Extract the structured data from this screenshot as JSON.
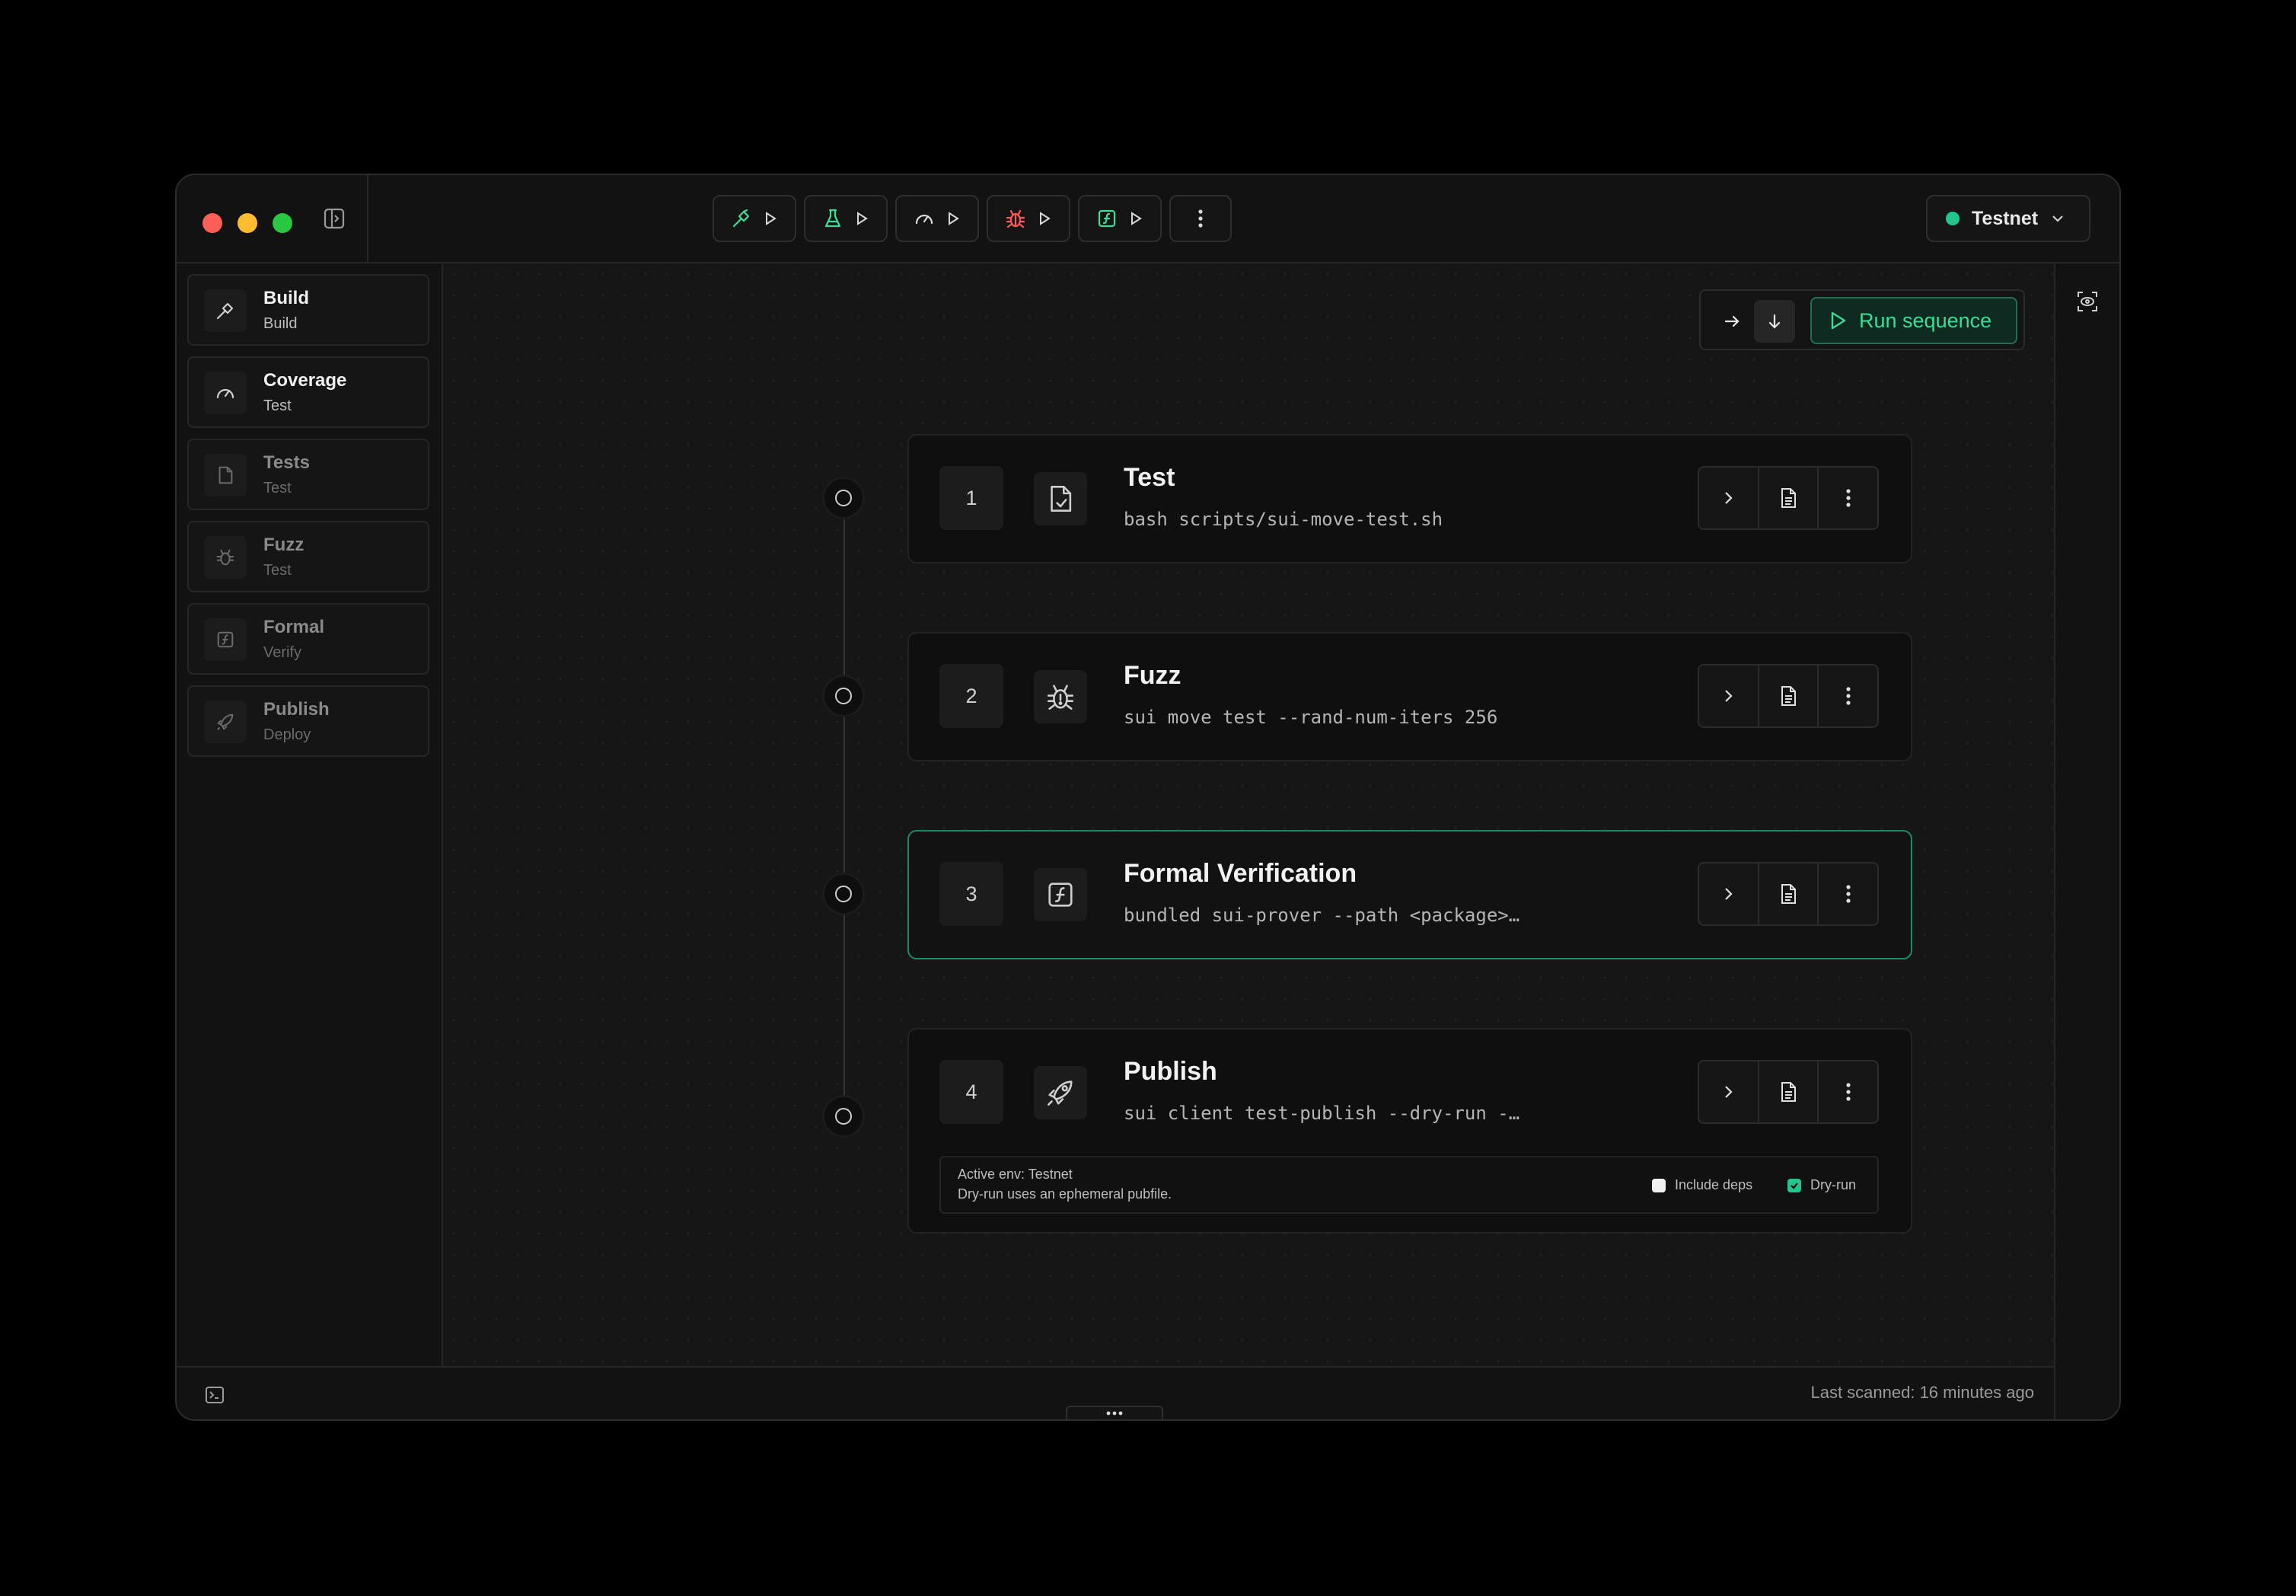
{
  "window": {
    "toolbar": [
      {
        "icon": "hammer-icon",
        "color": "#3ddc97"
      },
      {
        "icon": "flask-icon",
        "color": "#3ddc97"
      },
      {
        "icon": "gauge-icon",
        "color": "#d8d8d8"
      },
      {
        "icon": "bug-icon",
        "color": "#ff5a5a"
      },
      {
        "icon": "formal-icon",
        "color": "#3ddc97"
      }
    ],
    "env": {
      "label": "Testnet",
      "status_color": "#22c58b"
    }
  },
  "sidebar": {
    "items": [
      {
        "title": "Build",
        "subtitle": "Build",
        "icon": "hammer-icon"
      },
      {
        "title": "Coverage",
        "subtitle": "Test",
        "icon": "gauge-icon"
      },
      {
        "title": "Tests",
        "subtitle": "Test",
        "icon": "file-check-icon"
      },
      {
        "title": "Fuzz",
        "subtitle": "Test",
        "icon": "bug-icon"
      },
      {
        "title": "Formal",
        "subtitle": "Verify",
        "icon": "formal-icon"
      },
      {
        "title": "Publish",
        "subtitle": "Deploy",
        "icon": "rocket-icon"
      }
    ]
  },
  "run_panel": {
    "run_label": "Run sequence",
    "accent": "#3ddc97"
  },
  "steps": [
    {
      "number": "1",
      "title": "Test",
      "command": "bash scripts/sui-move-test.sh",
      "icon": "file-check-icon"
    },
    {
      "number": "2",
      "title": "Fuzz",
      "command": "sui move test --rand-num-iters 256",
      "icon": "bug-icon"
    },
    {
      "number": "3",
      "title": "Formal Verification",
      "command": "bundled sui-prover --path <package>…",
      "icon": "formal-icon",
      "active": true
    },
    {
      "number": "4",
      "title": "Publish",
      "command": "sui client test-publish --dry-run -…",
      "icon": "rocket-icon"
    }
  ],
  "publish_options": {
    "env_line": "Active env: Testnet",
    "note_line": "Dry-run uses an ephemeral pubfile.",
    "include_deps_label": "Include deps",
    "include_deps_checked": false,
    "dry_run_label": "Dry-run",
    "dry_run_checked": true
  },
  "status": {
    "last_scanned": "Last scanned: 16 minutes ago"
  }
}
